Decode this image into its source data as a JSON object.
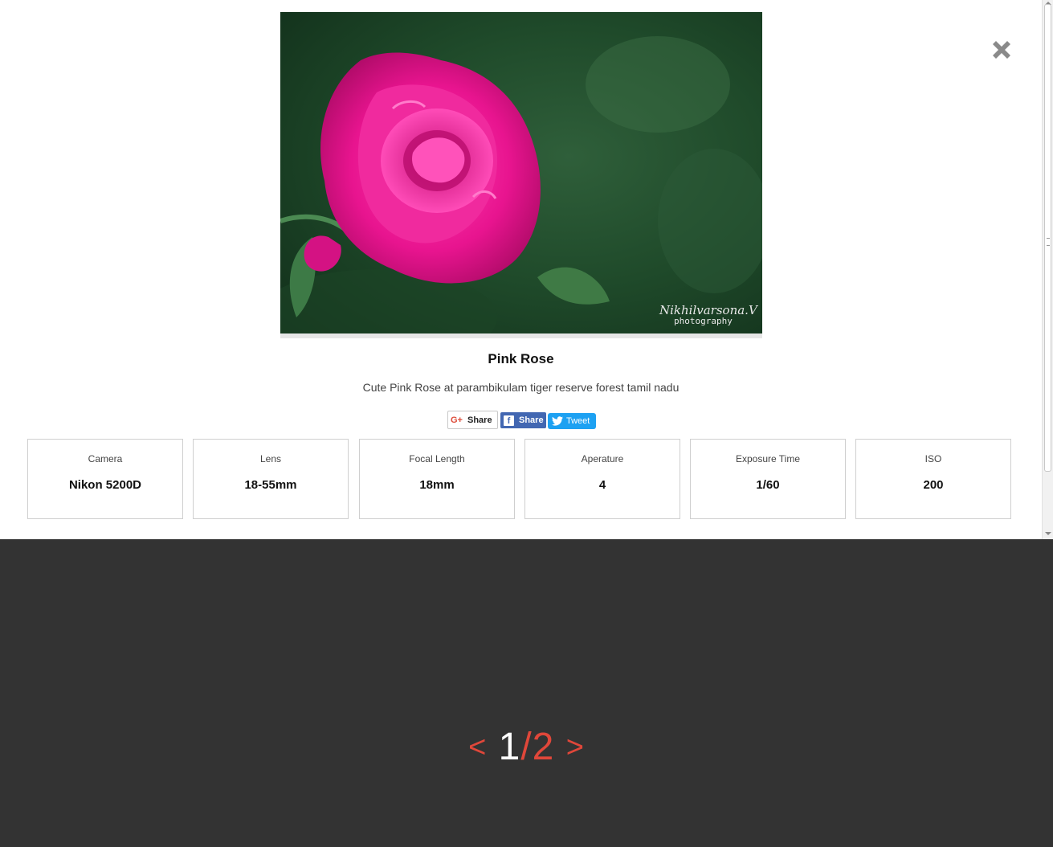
{
  "lightbox": {
    "close_icon": "close-x-icon",
    "photo": {
      "subject": "pink-rose",
      "watermark_line1": "Nikhilvarsona.V",
      "watermark_line2": "photography"
    },
    "title": "Pink Rose",
    "description": "Cute Pink Rose at parambikulam tiger reserve forest tamil nadu",
    "share": {
      "gplus_label": "Share",
      "facebook_label": "Share",
      "twitter_label": "Tweet"
    },
    "specs": [
      {
        "label": "Camera",
        "value": "Nikon 5200D"
      },
      {
        "label": "Lens",
        "value": "18-55mm"
      },
      {
        "label": "Focal Length",
        "value": "18mm"
      },
      {
        "label": "Aperature",
        "value": "4"
      },
      {
        "label": "Exposure Time",
        "value": "1/60"
      },
      {
        "label": "ISO",
        "value": "200"
      }
    ]
  },
  "pager": {
    "prev": "<",
    "current": "1",
    "separator": "/",
    "total": "2",
    "next": ">"
  },
  "colors": {
    "accent": "#e0473a",
    "backdrop": "#333333",
    "facebook": "#4267b2",
    "twitter": "#1da1f2"
  }
}
